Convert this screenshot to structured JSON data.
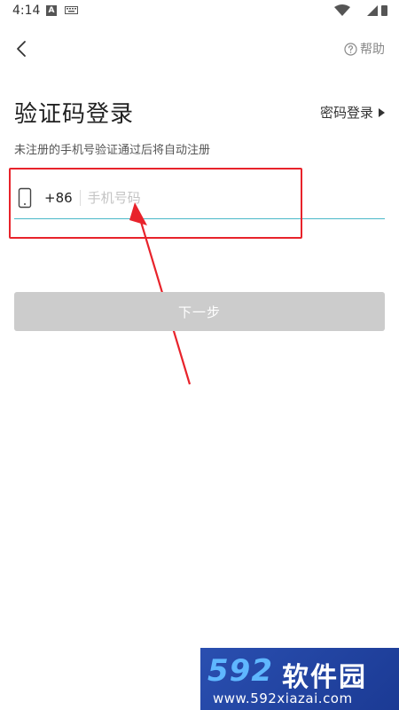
{
  "status_bar": {
    "time": "4:14",
    "notification_icons": [
      "a-app-icon",
      "keyboard-icon"
    ],
    "system_icons": [
      "wifi-icon",
      "signal-icon",
      "battery-icon"
    ]
  },
  "nav": {
    "back_icon": "chevron-left-icon",
    "help_label": "帮助",
    "help_icon": "question-circle-icon"
  },
  "header": {
    "title": "验证码登录",
    "password_login_label": "密码登录",
    "subtitle": "未注册的手机号验证通过后将自动注册"
  },
  "phone_input": {
    "icon": "phone-icon",
    "country_code": "+86",
    "value": "",
    "placeholder": "手机号码"
  },
  "next_button": {
    "label": "下一步"
  },
  "annotation": {
    "color": "#e8232b"
  },
  "watermark": {
    "brand_number": "592",
    "brand_text": "软件园",
    "url": "www.592xiazai.com"
  },
  "colors": {
    "accent_underline": "#4ab8c8",
    "button_disabled": "#cccccc",
    "watermark_bg": "#1b3a94"
  }
}
